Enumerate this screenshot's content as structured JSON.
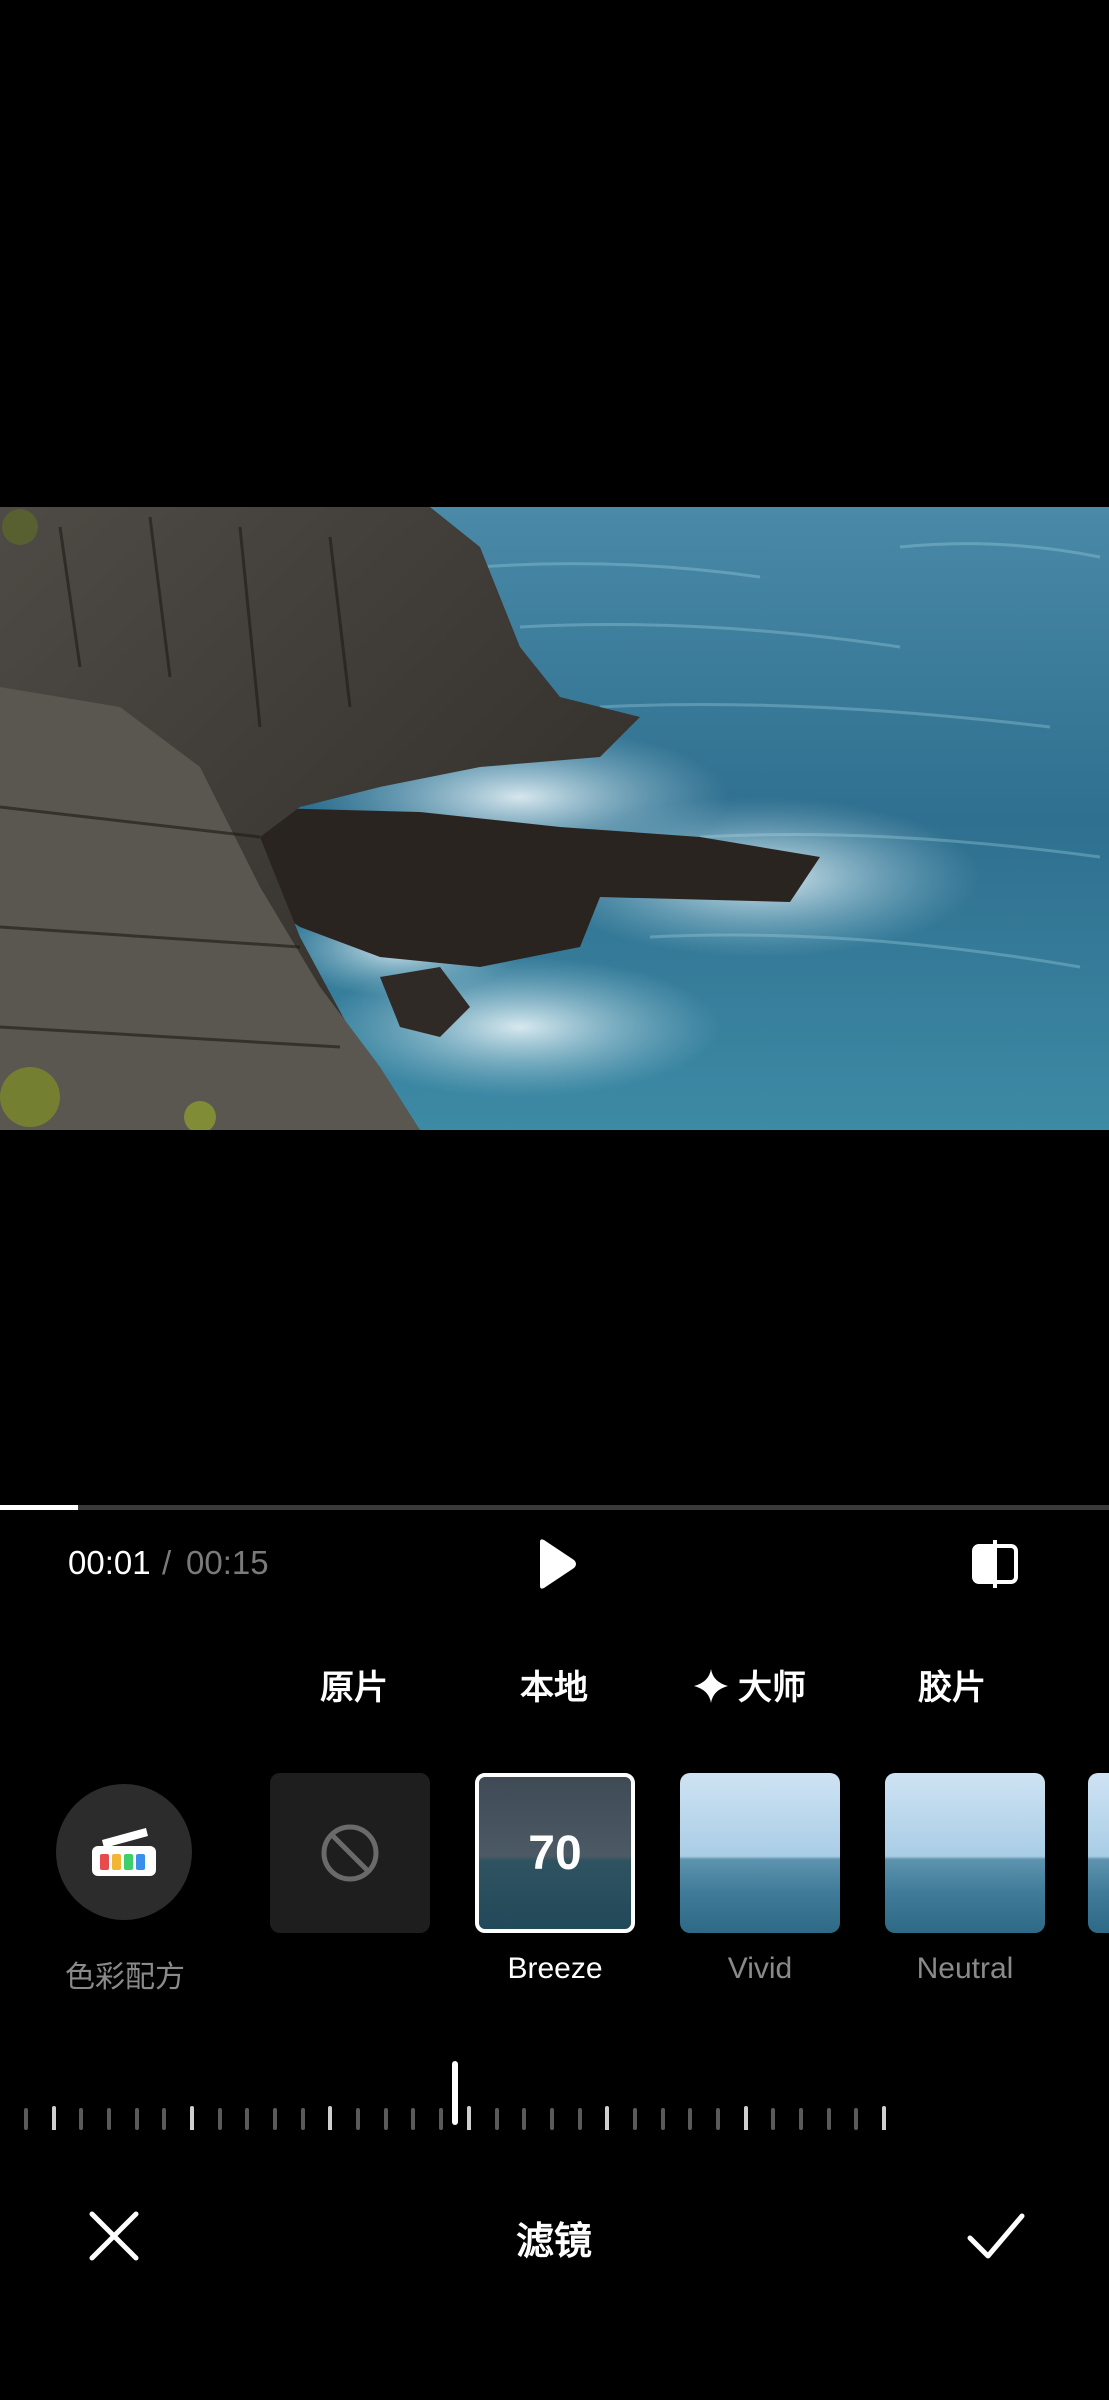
{
  "playback": {
    "current_time": "00:01",
    "separator": "/",
    "total_time": "00:15",
    "progress_fraction": 0.07
  },
  "tabs": [
    {
      "label": "原片"
    },
    {
      "label": "本地"
    },
    {
      "label": "大师",
      "icon": "sparkle-icon"
    },
    {
      "label": "胶片"
    }
  ],
  "color_recipe": {
    "label": "色彩配方",
    "icon": "color-palette-icon"
  },
  "filters": [
    {
      "label": "",
      "icon": "none-icon"
    },
    {
      "label": "Breeze",
      "value": "70",
      "selected": true
    },
    {
      "label": "Vivid"
    },
    {
      "label": "Neutral"
    }
  ],
  "slider": {
    "value_fraction": 0.5
  },
  "bottom_bar": {
    "title": "滤镜",
    "cancel_icon": "close-icon",
    "confirm_icon": "check-icon"
  },
  "colors": {
    "background": "#000000",
    "accent": "#ffffff",
    "muted_text": "#8a8a8a",
    "tile_bg": "#1e1e1e"
  }
}
